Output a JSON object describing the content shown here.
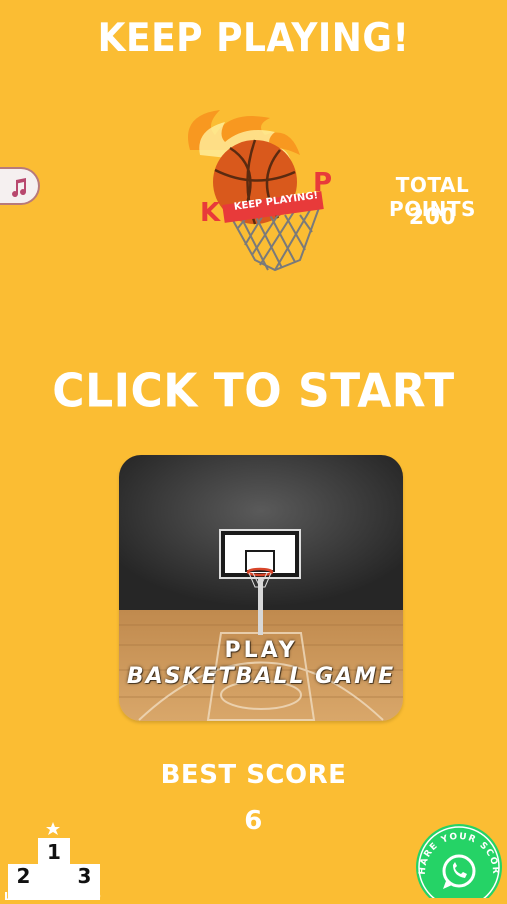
{
  "header": {
    "title": "KEEP PLAYING!"
  },
  "logo": {
    "banner_text": "KEEP PLAYING!",
    "letter_left": "K",
    "letter_right": "P"
  },
  "stats": {
    "total_points_label": "TOTAL POINTS",
    "total_points_value": "200"
  },
  "start": {
    "label": "CLICK TO START"
  },
  "play_card": {
    "line1": "PLAY",
    "line2": "BASKETBALL GAME"
  },
  "best": {
    "label": "BEST SCORE",
    "value": "6"
  },
  "leaderboard": {
    "label": "LEADERBOARD",
    "first": "1",
    "second": "2",
    "third": "3"
  },
  "share": {
    "label": "SHARE YOUR SCORE"
  },
  "icons": {
    "music": "music-note-icon",
    "share": "whatsapp-icon",
    "leaderboard": "podium-icon"
  },
  "colors": {
    "background": "#fbbd33",
    "text": "#ffffff",
    "whatsapp": "#25d366"
  }
}
